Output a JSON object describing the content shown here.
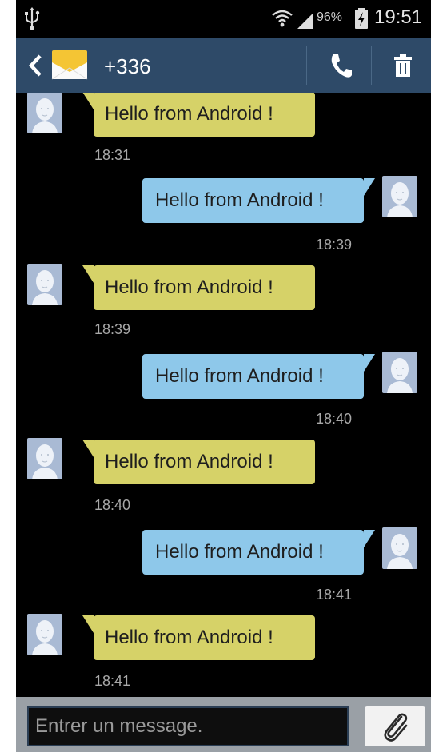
{
  "status_bar": {
    "battery_percent": "96%",
    "time": "19:51",
    "icons": [
      "usb-icon",
      "wifi-icon",
      "signal-icon",
      "battery-charging-icon"
    ]
  },
  "header": {
    "contact": "+336",
    "icons": [
      "back-icon",
      "envelope-icon",
      "phone-icon",
      "trash-icon"
    ]
  },
  "messages": [
    {
      "direction": "incoming",
      "text": "Hello from Android !",
      "time": "18:31"
    },
    {
      "direction": "outgoing",
      "text": "Hello from Android !",
      "time": "18:39"
    },
    {
      "direction": "incoming",
      "text": "Hello from Android !",
      "time": "18:39"
    },
    {
      "direction": "outgoing",
      "text": "Hello from Android !",
      "time": "18:40"
    },
    {
      "direction": "incoming",
      "text": "Hello from Android !",
      "time": "18:40"
    },
    {
      "direction": "outgoing",
      "text": "Hello from Android !",
      "time": "18:41"
    },
    {
      "direction": "incoming",
      "text": "Hello from Android !",
      "time": "18:41"
    }
  ],
  "composer": {
    "placeholder": "Entrer un message.",
    "icons": [
      "paperclip-icon"
    ]
  },
  "colors": {
    "header_bg": "#2e4a68",
    "incoming_bubble": "#d6d268",
    "outgoing_bubble": "#8ec8ea",
    "timestamp": "#a8a8a8"
  }
}
